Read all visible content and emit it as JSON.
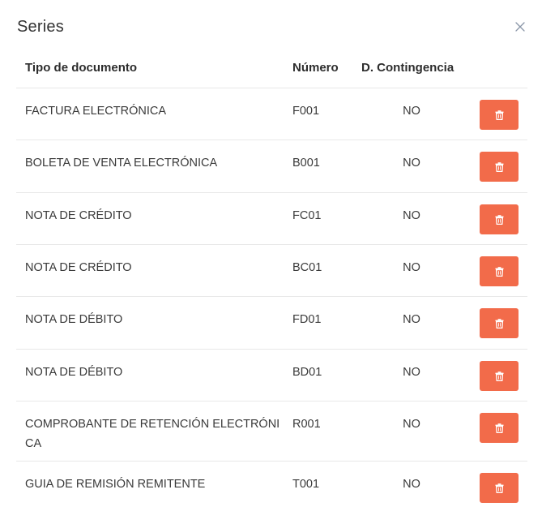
{
  "dialog": {
    "title": "Series"
  },
  "table": {
    "headers": {
      "tipo": "Tipo de documento",
      "numero": "Número",
      "contingencia": "D. Contingencia"
    },
    "rows": [
      {
        "tipo": "FACTURA ELECTRÓNICA",
        "numero": "F001",
        "contingencia": "NO"
      },
      {
        "tipo": "BOLETA DE VENTA ELECTRÓNICA",
        "numero": "B001",
        "contingencia": "NO"
      },
      {
        "tipo": "NOTA DE CRÉDITO",
        "numero": "FC01",
        "contingencia": "NO"
      },
      {
        "tipo": "NOTA DE CRÉDITO",
        "numero": "BC01",
        "contingencia": "NO"
      },
      {
        "tipo": "NOTA DE DÉBITO",
        "numero": "FD01",
        "contingencia": "NO"
      },
      {
        "tipo": "NOTA DE DÉBITO",
        "numero": "BD01",
        "contingencia": "NO"
      },
      {
        "tipo": "COMPROBANTE DE RETENCIÓN ELECTRÓNICA",
        "numero": "R001",
        "contingencia": "NO"
      },
      {
        "tipo": "GUIA DE REMISIÓN REMITENTE",
        "numero": "T001",
        "contingencia": "NO"
      }
    ]
  },
  "icons": {
    "close": "close-icon",
    "delete": "trash-icon"
  },
  "colors": {
    "delete_button": "#f26b4a",
    "close_icon": "#8a96a8"
  }
}
